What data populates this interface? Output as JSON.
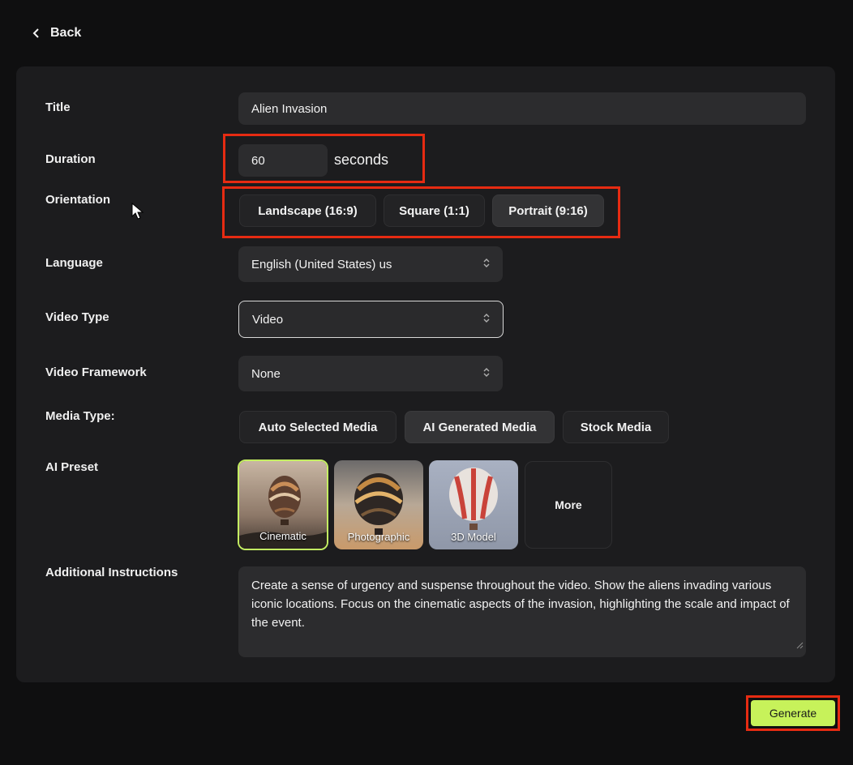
{
  "nav": {
    "back_label": "Back"
  },
  "form": {
    "title": {
      "label": "Title",
      "value": "Alien Invasion"
    },
    "duration": {
      "label": "Duration",
      "value": "60",
      "unit": "seconds"
    },
    "orientation": {
      "label": "Orientation",
      "options": [
        "Landscape (16:9)",
        "Square (1:1)",
        "Portrait (9:16)"
      ],
      "selected": "Portrait (9:16)"
    },
    "language": {
      "label": "Language",
      "value": "English (United States) us"
    },
    "video_type": {
      "label": "Video Type",
      "value": "Video"
    },
    "video_framework": {
      "label": "Video Framework",
      "value": "None"
    },
    "media_type": {
      "label": "Media Type:",
      "options": [
        "Auto Selected Media",
        "AI Generated Media",
        "Stock Media"
      ],
      "selected": "AI Generated Media"
    },
    "ai_preset": {
      "label": "AI Preset",
      "presets": [
        "Cinematic",
        "Photographic",
        "3D Model"
      ],
      "selected": "Cinematic",
      "more_label": "More"
    },
    "additional_instructions": {
      "label": "Additional Instructions",
      "value": "Create a sense of urgency and suspense throughout the video. Show the aliens invading various iconic locations. Focus on the cinematic aspects of the invasion, highlighting the scale and impact of the event."
    }
  },
  "actions": {
    "generate_label": "Generate"
  },
  "colors": {
    "accent": "#c7f25a",
    "highlight": "#e62b12",
    "panel": "#1c1c1e",
    "background": "#0f0f10"
  }
}
